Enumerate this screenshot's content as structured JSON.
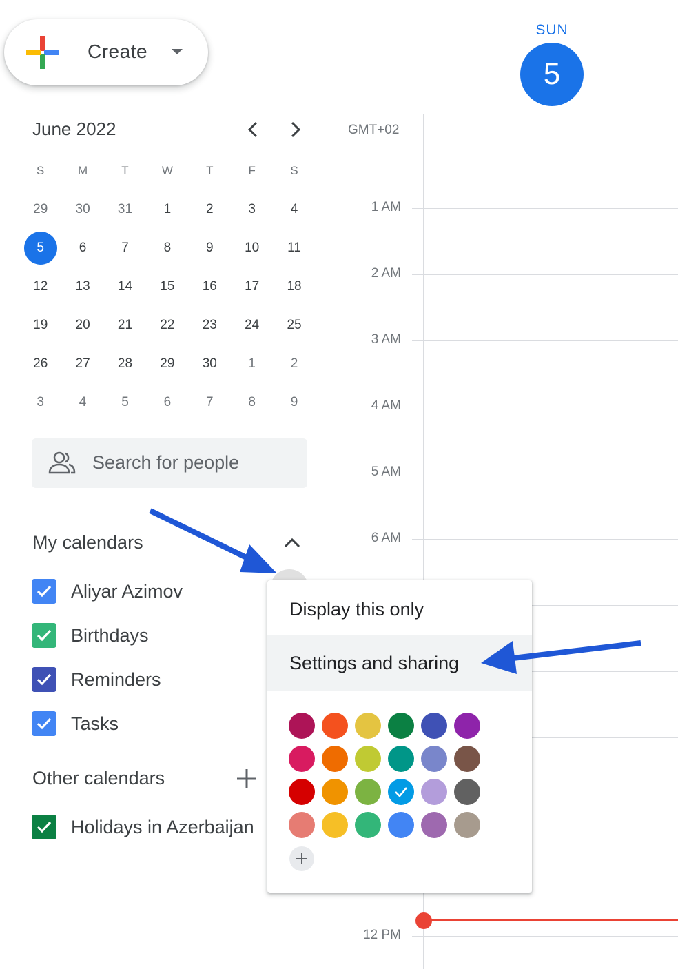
{
  "create": {
    "label": "Create"
  },
  "day_header": {
    "name": "SUN",
    "number": "5"
  },
  "mini_calendar": {
    "title": "June 2022",
    "weekdays": [
      "S",
      "M",
      "T",
      "W",
      "T",
      "F",
      "S"
    ],
    "weeks": [
      [
        "29",
        "30",
        "31",
        "1",
        "2",
        "3",
        "4"
      ],
      [
        "5",
        "6",
        "7",
        "8",
        "9",
        "10",
        "11"
      ],
      [
        "12",
        "13",
        "14",
        "15",
        "16",
        "17",
        "18"
      ],
      [
        "19",
        "20",
        "21",
        "22",
        "23",
        "24",
        "25"
      ],
      [
        "26",
        "27",
        "28",
        "29",
        "30",
        "1",
        "2"
      ],
      [
        "3",
        "4",
        "5",
        "6",
        "7",
        "8",
        "9"
      ]
    ],
    "today": "5"
  },
  "search": {
    "placeholder": "Search for people"
  },
  "my_calendars": {
    "title": "My calendars",
    "items": [
      {
        "label": "Aliyar Azimov",
        "color": "#4285f4"
      },
      {
        "label": "Birthdays",
        "color": "#33b679"
      },
      {
        "label": "Reminders",
        "color": "#3f51b5"
      },
      {
        "label": "Tasks",
        "color": "#4285f4"
      }
    ]
  },
  "other_calendars": {
    "title": "Other calendars",
    "items": [
      {
        "label": "Holidays in Azerbaijan",
        "color": "#0b8043"
      }
    ]
  },
  "timegrid": {
    "timezone": "GMT+02",
    "hours": [
      "1 AM",
      "2 AM",
      "3 AM",
      "4 AM",
      "5 AM",
      "6 AM",
      "12 PM"
    ]
  },
  "menu": {
    "display_only": "Display this only",
    "settings_sharing": "Settings and sharing",
    "colors": [
      "#ad1457",
      "#f4511e",
      "#e4c441",
      "#0b8043",
      "#3f51b5",
      "#8e24aa",
      "#d81b60",
      "#ef6c00",
      "#c0ca33",
      "#009688",
      "#7986cb",
      "#795548",
      "#d50000",
      "#f09300",
      "#7cb342",
      "#039be5",
      "#b39ddb",
      "#616161",
      "#e67c73",
      "#f6bf26",
      "#33b679",
      "#4285f4",
      "#9e69af",
      "#a79b8e"
    ],
    "selected_color": "#039be5"
  },
  "colors": {
    "accent": "#1a73e8",
    "arrow": "#1f57d6",
    "now": "#ea4335"
  }
}
